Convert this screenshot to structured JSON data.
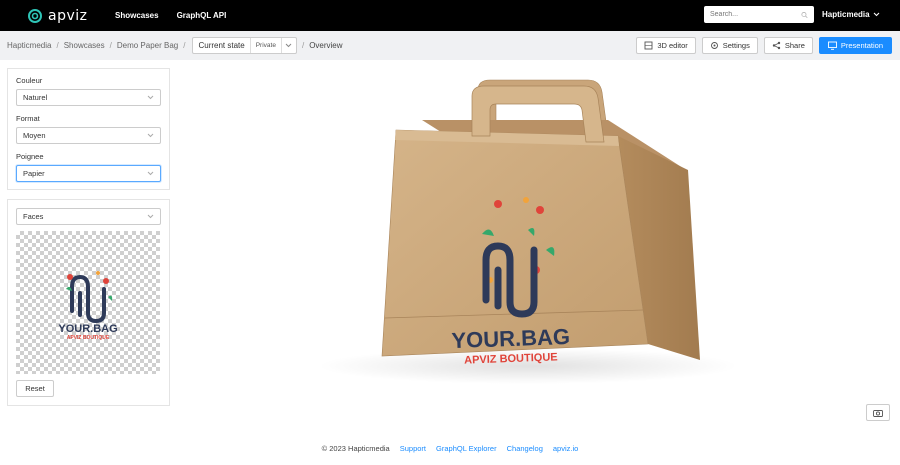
{
  "brand": {
    "name": "apviz"
  },
  "nav": {
    "showcases": "Showcases",
    "graphql": "GraphQL API"
  },
  "search": {
    "placeholder": "Search..."
  },
  "user": {
    "name": "Hapticmedia"
  },
  "breadcrumb": {
    "items": [
      "Hapticmedia",
      "Showcases",
      "Demo Paper Bag"
    ],
    "state_label": "Current state",
    "state_badge": "Private",
    "current": "Overview"
  },
  "actions": {
    "editor": "3D editor",
    "settings": "Settings",
    "share": "Share",
    "presentation": "Presentation"
  },
  "config": {
    "couleur_label": "Couleur",
    "couleur_value": "Naturel",
    "format_label": "Format",
    "format_value": "Moyen",
    "poignee_label": "Poignee",
    "poignee_value": "Papier"
  },
  "faces": {
    "select_value": "Faces",
    "reset": "Reset"
  },
  "artwork": {
    "line1": "YOUR.BAG",
    "line2": "APVIZ BOUTIQUE"
  },
  "footer": {
    "copyright": "© 2023 Hapticmedia",
    "support": "Support",
    "explorer": "GraphQL Explorer",
    "changelog": "Changelog",
    "site": "apviz.io"
  },
  "colors": {
    "primary": "#1a8cff",
    "topbar": "#000000",
    "kraft": "#c9a57a",
    "logo_navy": "#2e3a59",
    "logo_red": "#e0443a"
  }
}
